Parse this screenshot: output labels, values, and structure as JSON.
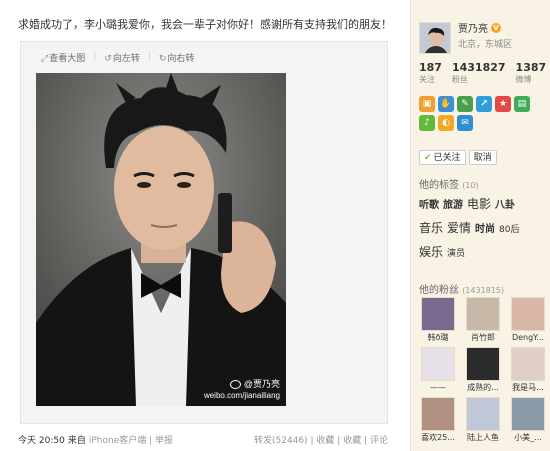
{
  "post": {
    "text": "求婚成功了，李小璐我爱你，我会一辈子对你好！感谢所有支持我们的朋友！",
    "actions": {
      "view_large": "查看大图",
      "rotate_left": "向左转",
      "rotate_right": "向右转"
    },
    "watermark": {
      "user": "@贾乃亮",
      "url": "weibo.com/jianailiang"
    },
    "meta": {
      "time": "今天 20:50",
      "from_label": "来自",
      "source": "iPhone客户端",
      "report": "举报",
      "repost": "转发(52446)",
      "collect": "收藏",
      "favorite": "收藏",
      "comment": "评论"
    }
  },
  "profile": {
    "name": "贾乃亮",
    "location": "北京，东城区",
    "stats": [
      {
        "num": "187",
        "label": "关注"
      },
      {
        "num": "1431827",
        "label": "粉丝"
      },
      {
        "num": "1387",
        "label": "微博"
      }
    ],
    "app_icons": [
      {
        "name": "id-card-icon",
        "color": "#f0a030",
        "glyph": "▣"
      },
      {
        "name": "hand-icon",
        "color": "#3a8fd9",
        "glyph": "✋"
      },
      {
        "name": "edit-icon",
        "color": "#4aa04a",
        "glyph": "✎"
      },
      {
        "name": "share-icon",
        "color": "#2f9ed8",
        "glyph": "↗"
      },
      {
        "name": "game-icon",
        "color": "#e24a4a",
        "glyph": "★"
      },
      {
        "name": "grow-icon",
        "color": "#3fae5a",
        "glyph": "▤"
      },
      {
        "name": "sound-icon",
        "color": "#64b83c",
        "glyph": "♪"
      },
      {
        "name": "tv-icon",
        "color": "#f5a623",
        "glyph": "◐"
      },
      {
        "name": "sticky-icon",
        "color": "#2e8fd0",
        "glyph": "✉"
      }
    ],
    "followed_label": "已关注",
    "unfollow_label": "取消"
  },
  "tags": {
    "title": "他的标签",
    "count": "(10)",
    "items": [
      {
        "label": "听歌",
        "size": "t1"
      },
      {
        "label": "旅游",
        "size": "t1"
      },
      {
        "label": "电影",
        "size": "t2"
      },
      {
        "label": "八卦",
        "size": "t1"
      },
      {
        "label": "音乐",
        "size": "t2"
      },
      {
        "label": "爱情",
        "size": "t2"
      },
      {
        "label": "时尚",
        "size": "t1"
      },
      {
        "label": "80后",
        "size": "t3"
      },
      {
        "label": "娱乐",
        "size": "t2"
      },
      {
        "label": "演员",
        "size": "t3"
      }
    ]
  },
  "fans": {
    "title": "他的粉丝",
    "count": "(1431815)",
    "items": [
      {
        "name": "韩ð璐",
        "color": "#7a6a90"
      },
      {
        "name": "肖竹郎",
        "color": "#c8b8a8"
      },
      {
        "name": "DengY...",
        "color": "#d8b7a7"
      },
      {
        "name": "——",
        "color": "#e8e0e8"
      },
      {
        "name": "成熟的...",
        "color": "#2b2b2b"
      },
      {
        "name": "我是马...",
        "color": "#e0cfc5"
      },
      {
        "name": "喜欢25...",
        "color": "#b09080"
      },
      {
        "name": "陆上人鱼",
        "color": "#c0c8d8"
      },
      {
        "name": "小美_...",
        "color": "#8a9aa8"
      }
    ]
  }
}
